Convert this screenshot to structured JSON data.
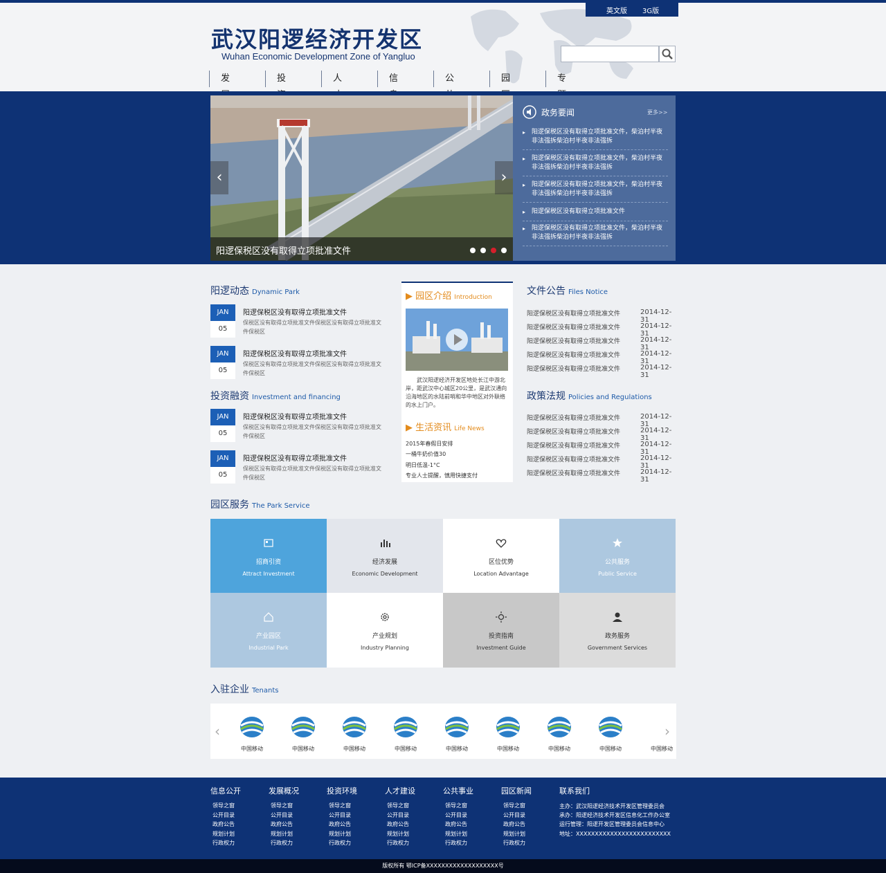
{
  "lang": {
    "en": "英文版",
    "g3": "3G版"
  },
  "logo": {
    "cn": "武汉阳逻经济开发区",
    "en": "Wuhan Economic Development Zone of Yangluo"
  },
  "search": {
    "placeholder": ""
  },
  "nav": [
    "发展概况",
    "投资环境",
    "人才建设",
    "信息公开",
    "公共事业",
    "园区新闻",
    "专题"
  ],
  "slider": {
    "caption": "阳逻保税区没有取得立项批准文件",
    "active_dot": 2,
    "dots": 4
  },
  "gov_news": {
    "title": "政务要闻",
    "more": "更多>>",
    "items": [
      "阳逻保税区没有取得立项批准文件，柴泊村半夜非法强拆柴泊村半夜非法强拆",
      "阳逻保税区没有取得立项批准文件，柴泊村半夜非法强拆柴泊村半夜非法强拆",
      "阳逻保税区没有取得立项批准文件，柴泊村半夜非法强拆柴泊村半夜非法强拆",
      "阳逻保税区没有取得立项批准文件",
      "阳逻保税区没有取得立项批准文件，柴泊村半夜非法强拆柴泊村半夜非法强拆"
    ]
  },
  "dynamic": {
    "title": "阳逻动态",
    "title_en": "Dynamic Park",
    "items": [
      {
        "month": "JAN",
        "day": "05",
        "title": "阳逻保税区没有取得立项批准文件",
        "desc": "保税区没有取得立项批准文件保税区没有取得立项批准文件保税区"
      },
      {
        "month": "JAN",
        "day": "05",
        "title": "阳逻保税区没有取得立项批准文件",
        "desc": "保税区没有取得立项批准文件保税区没有取得立项批准文件保税区"
      }
    ]
  },
  "investment": {
    "title": "投资融资",
    "title_en": "Investment and financing",
    "items": [
      {
        "month": "JAN",
        "day": "05",
        "title": "阳逻保税区没有取得立项批准文件",
        "desc": "保税区没有取得立项批准文件保税区没有取得立项批准文件保税区"
      },
      {
        "month": "JAN",
        "day": "05",
        "title": "阳逻保税区没有取得立项批准文件",
        "desc": "保税区没有取得立项批准文件保税区没有取得立项批准文件保税区"
      }
    ]
  },
  "intro": {
    "title": "园区介绍",
    "title_en": "Introduction",
    "text": "武汉阳逻经济开发区地处长江中游北岸，距武汉中心城区20公里，是武汉通向沿海地区的水陆前哨和华中地区对外联络的水上门户。",
    "life_title": "生活资讯",
    "life_title_en": "Life News",
    "life": [
      "2015年春假日安排",
      "一桶牛奶价值30",
      "明日低温-1°C",
      "专业人士提醒，慎用快捷支付"
    ]
  },
  "files": {
    "title": "文件公告",
    "title_en": "Files Notice",
    "items": [
      {
        "t": "阳逻保税区没有取得立项批准文件",
        "d": "2014-12-31"
      },
      {
        "t": "阳逻保税区没有取得立项批准文件",
        "d": "2014-12-31"
      },
      {
        "t": "阳逻保税区没有取得立项批准文件",
        "d": "2014-12-31"
      },
      {
        "t": "阳逻保税区没有取得立项批准文件",
        "d": "2014-12-31"
      },
      {
        "t": "阳逻保税区没有取得立项批准文件",
        "d": "2014-12-31"
      }
    ]
  },
  "policies": {
    "title": "政策法规",
    "title_en": "Policies and Regulations",
    "items": [
      {
        "t": "阳逻保税区没有取得立项批准文件",
        "d": "2014-12-31"
      },
      {
        "t": "阳逻保税区没有取得立项批准文件",
        "d": "2014-12-31"
      },
      {
        "t": "阳逻保税区没有取得立项批准文件",
        "d": "2014-12-31"
      },
      {
        "t": "阳逻保税区没有取得立项批准文件",
        "d": "2014-12-31"
      },
      {
        "t": "阳逻保税区没有取得立项批准文件",
        "d": "2014-12-31"
      }
    ]
  },
  "service": {
    "title": "园区服务",
    "title_en": "The Park Service",
    "items": [
      {
        "cn": "招商引资",
        "en": "Attract Investment",
        "icon": "card-icon",
        "bg": "#4ea4dc",
        "fg": "#ffffff"
      },
      {
        "cn": "经济发展",
        "en": "Economic Development",
        "icon": "bar-chart-icon",
        "bg": "#e3e6ec",
        "fg": "#333333"
      },
      {
        "cn": "区位优势",
        "en": "Location Advantage",
        "icon": "heart-icon",
        "bg": "#ffffff",
        "fg": "#333333"
      },
      {
        "cn": "公共服务",
        "en": "Public Service",
        "icon": "star-hand-icon",
        "bg": "#adc8e0",
        "fg": "#ffffff"
      },
      {
        "cn": "产业园区",
        "en": "Industrial Park",
        "icon": "home-icon",
        "bg": "#adc8e0",
        "fg": "#ffffff"
      },
      {
        "cn": "产业规划",
        "en": "Industry Planning",
        "icon": "gear-icon",
        "bg": "#ffffff",
        "fg": "#333333"
      },
      {
        "cn": "投资指南",
        "en": "Investment Guide",
        "icon": "sun-icon",
        "bg": "#c8c8c8",
        "fg": "#333333"
      },
      {
        "cn": "政务服务",
        "en": "Government Services",
        "icon": "person-icon",
        "bg": "#dcdcdc",
        "fg": "#333333"
      }
    ]
  },
  "tenants": {
    "title": "入驻企业",
    "title_en": "Tenants",
    "items": [
      "中国移动",
      "中国移动",
      "中国移动",
      "中国移动",
      "中国移动",
      "中国移动",
      "中国移动",
      "中国移动",
      "中国移动"
    ]
  },
  "footer": {
    "cols": [
      {
        "h": "信息公开",
        "links": [
          "领导之窗",
          "公开目录",
          "政府公告",
          "规划计划",
          "行政权力"
        ]
      },
      {
        "h": "发展概况",
        "links": [
          "领导之窗",
          "公开目录",
          "政府公告",
          "规划计划",
          "行政权力"
        ]
      },
      {
        "h": "投资环境",
        "links": [
          "领导之窗",
          "公开目录",
          "政府公告",
          "规划计划",
          "行政权力"
        ]
      },
      {
        "h": "人才建设",
        "links": [
          "领导之窗",
          "公开目录",
          "政府公告",
          "规划计划",
          "行政权力"
        ]
      },
      {
        "h": "公共事业",
        "links": [
          "领导之窗",
          "公开目录",
          "政府公告",
          "规划计划",
          "行政权力"
        ]
      },
      {
        "h": "园区新闻",
        "links": [
          "领导之窗",
          "公开目录",
          "政府公告",
          "规划计划",
          "行政权力"
        ]
      }
    ],
    "contact_title": "联系我们",
    "contact": [
      "主办：武汉阳逻经济技术开发区管理委员会",
      "承办：阳逻经济技术开发区信息化工作办公室",
      "运行管理：阳逻开发区管理委员会信息中心",
      "地址：XXXXXXXXXXXXXXXXXXXXXXXXX"
    ],
    "copyright": "版权所有 鄂ICP备XXXXXXXXXXXXXXXXXXX号"
  },
  "colors": {
    "brand": "#0e3275",
    "accent": "#e38b1c",
    "news_panel": "#4d6b9c"
  }
}
